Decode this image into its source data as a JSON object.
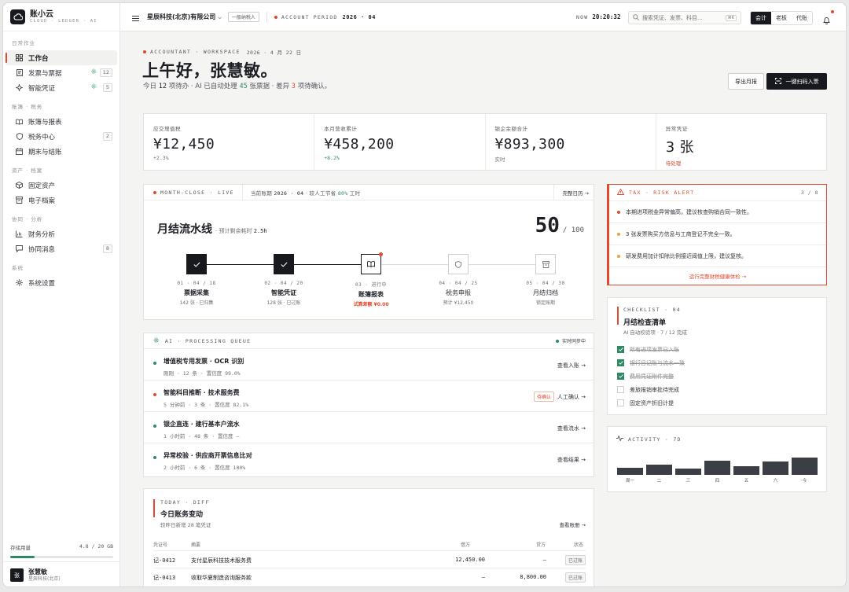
{
  "brand": {
    "name": "账小云",
    "sub": "CLOUD · LEDGER · AI"
  },
  "sidebar": {
    "sections": [
      {
        "title": "日常作业",
        "items": [
          {
            "label": "工作台",
            "icon": "grid-icon",
            "active": true
          },
          {
            "label": "发票与票据",
            "icon": "receipt-icon",
            "badge": "12",
            "ai": true
          },
          {
            "label": "智能凭证",
            "icon": "sparkle-icon",
            "badge": "5",
            "ai": true
          }
        ]
      },
      {
        "title": "账簿 · 税务",
        "items": [
          {
            "label": "账簿与报表",
            "icon": "book-icon"
          },
          {
            "label": "税务中心",
            "icon": "shield-icon",
            "badge": "2"
          },
          {
            "label": "期末与结账",
            "icon": "calendar-icon"
          }
        ]
      },
      {
        "title": "资产 · 档案",
        "items": [
          {
            "label": "固定资产",
            "icon": "cube-icon"
          },
          {
            "label": "电子档案",
            "icon": "archive-icon"
          }
        ]
      },
      {
        "title": "协同 · 分析",
        "items": [
          {
            "label": "财务分析",
            "icon": "chart-icon"
          },
          {
            "label": "协同消息",
            "icon": "message-icon",
            "badge": "8"
          }
        ]
      },
      {
        "title": "系统",
        "items": [
          {
            "label": "系统设置",
            "icon": "gear-icon"
          }
        ]
      }
    ],
    "storage": {
      "label": "存储用量",
      "value": "4.8 / 20 GB",
      "fraction": 0.24
    },
    "user": {
      "avatar": "张",
      "name": "张慧敏",
      "org": "星辰科技(北京)"
    }
  },
  "topbar": {
    "company": "星辰科技(北京)有限公司",
    "taxpayer_tag": "一般纳税人",
    "period_label": "ACCOUNT PERIOD",
    "period_value": "2026 · 04",
    "now_label": "NOW",
    "now_value": "20:20:32",
    "search_placeholder": "搜索凭证、发票、科目...",
    "search_kbd": "⌘K",
    "roles": [
      "会计",
      "老板",
      "代账"
    ],
    "active_role": "会计"
  },
  "header": {
    "eyebrow": "ACCOUNTANT · WORKSPACE",
    "date": "2026 · 4 月 22 日",
    "greeting": "上午好，张慧敏。",
    "sub_pre": "今日",
    "sub_todo": "12",
    "sub_mid1": "项待办 · AI 已自动处理",
    "sub_ai": "45",
    "sub_mid2": "张票据 · 差异",
    "sub_diff": "3",
    "sub_post": "项待确认。",
    "export_btn": "导出月报",
    "scan_btn": "一键扫码入票"
  },
  "kpis": [
    {
      "label": "应交增值税",
      "value": "¥12,450",
      "sub": "+2.3%",
      "tone": "neutral"
    },
    {
      "label": "本月营收累计",
      "value": "¥458,200",
      "sub": "+8.2%",
      "tone": "green"
    },
    {
      "label": "银企余额合计",
      "value": "¥893,300",
      "sub": "实时",
      "tone": "neutral"
    },
    {
      "label": "异常凭证",
      "value": "3 张",
      "sub": "待处理",
      "tone": "red"
    }
  ],
  "pipeline": {
    "eyebrow": "MONTH-CLOSE · LIVE",
    "current_label": "当前账期",
    "current_value": "2026 · 04",
    "saving_pre": "· 较人工节省",
    "saving_pct": "80%",
    "saving_post": "工时",
    "calendar_link": "完整日历 →",
    "title": "月结流水线",
    "eta_label": "· 预计剩余耗时",
    "eta_value": "2.5h",
    "score": "50",
    "score_total": "/ 100",
    "steps": [
      {
        "idx": "01 · 04 / 18",
        "name": "票据采集",
        "sub": "142 张 · 已归集",
        "state": "done",
        "icon": "check-icon"
      },
      {
        "idx": "02 · 04 / 20",
        "name": "智能凭证",
        "sub": "128 张 · 已过账",
        "state": "done",
        "icon": "check-icon"
      },
      {
        "idx": "03 · 进行中",
        "name": "账簿报表",
        "sub": "试算差额 ¥0.00",
        "state": "current",
        "icon": "book-icon"
      },
      {
        "idx": "04 · 04 / 25",
        "name": "税务申报",
        "sub": "预计 ¥12,450",
        "state": "todo",
        "icon": "shield-icon"
      },
      {
        "idx": "05 · 04 / 30",
        "name": "月结归档",
        "sub": "锁定账期",
        "state": "todo",
        "icon": "archive-icon"
      }
    ]
  },
  "queue": {
    "eyebrow": "AI · PROCESSING QUEUE",
    "sync": "实时同步中",
    "items": [
      {
        "title": "增值税专用发票 · OCR 识别",
        "meta": "刚刚 · 12 条 · 置信度 99.0%",
        "action": "查看入账 →",
        "color": "#2f8a63"
      },
      {
        "title": "智能科目推断 · 技术服务费",
        "meta": "5 分钟前 · 3 条 · 置信度 82.1%",
        "action": "人工确认 →",
        "badge": "待确认",
        "color": "#e2492f"
      },
      {
        "title": "银企直连 · 建行基本户流水",
        "meta": "1 小时前 · 48 条 · 置信度 —",
        "action": "查看流水 →",
        "color": "#2f8a63"
      },
      {
        "title": "异常校验 · 供应商开票信息比对",
        "meta": "2 小时前 · 6 条 · 置信度 100%",
        "action": "查看结果 →",
        "color": "#2f8a63"
      }
    ]
  },
  "alert": {
    "eyebrow": "TAX · RISK ALERT",
    "page": "3 / 8",
    "items": [
      {
        "text": "本期进项税金异常偏高，建议核查购销合同一致性。",
        "color": "#e2492f"
      },
      {
        "text": "3 张发票购买方信息与工商登记不完全一致。",
        "color": "#e8a23a"
      },
      {
        "text": "研发费用加计扣除比例接近阈值上限，建议复核。",
        "color": "#e8a23a"
      }
    ],
    "link": "运行完整财税健康体检 →"
  },
  "checklist": {
    "eyebrow": "CHECKLIST · 04",
    "title": "月结检查清单",
    "sub": "AI 自动校验项 · 7 / 12 完成",
    "items": [
      {
        "label": "所有进项发票已入账",
        "done": true
      },
      {
        "label": "银行日记账与流水一致",
        "done": true
      },
      {
        "label": "费用凭证附件完整",
        "done": true
      },
      {
        "label": "差旅报销审批待完成",
        "done": false
      },
      {
        "label": "固定资产折旧计提",
        "done": false
      }
    ]
  },
  "activity": {
    "eyebrow": "ACTIVITY · 7D",
    "days": [
      "周一",
      "二",
      "三",
      "四",
      "五",
      "六",
      "今"
    ],
    "values": [
      0.36,
      0.52,
      0.32,
      0.72,
      0.44,
      0.68,
      0.88
    ]
  },
  "today": {
    "eyebrow": "TODAY · DIFF",
    "title": "今日账务变动",
    "sub": "较昨日新增 28 笔凭证",
    "link": "查看账册 →",
    "headers": {
      "no": "凭证号",
      "summary": "摘要",
      "debit": "借方",
      "credit": "贷方",
      "status": "状态"
    },
    "rows": [
      {
        "no": "记-0412",
        "summary": "支付星辰科技技术服务费",
        "debit": "12,450.00",
        "credit": "—",
        "status": "已过账"
      },
      {
        "no": "记-0413",
        "summary": "收取华夏制造咨询服务款",
        "debit": "—",
        "credit": "8,800.00",
        "status": "已过账"
      }
    ]
  },
  "colors": {
    "accent": "#e2492f",
    "green": "#2f8a63",
    "dark": "#17191f",
    "amber": "#e8a23a"
  }
}
